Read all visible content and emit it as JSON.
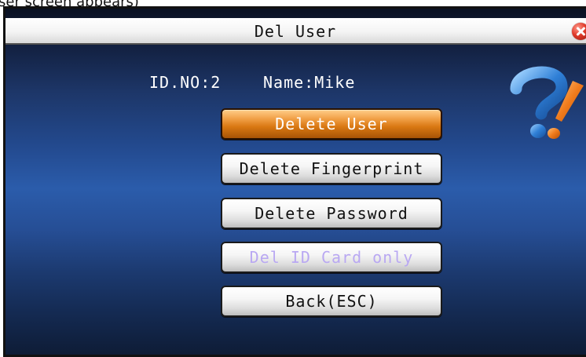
{
  "caption": "ser screen appears)",
  "window": {
    "title": "Del User",
    "close_icon": "close-icon"
  },
  "user_info": {
    "id_text": "ID.NO:2",
    "name_text": "Name:Mike"
  },
  "help_icon": "help-question-exclamation-icon",
  "menu": {
    "selected_index": 0,
    "items": [
      {
        "label": "Delete User",
        "state": "selected"
      },
      {
        "label": "Delete Fingerprint",
        "state": "normal"
      },
      {
        "label": "Delete Password",
        "state": "normal"
      },
      {
        "label": "Del ID Card only",
        "state": "disabled"
      },
      {
        "label": "Back(ESC)",
        "state": "normal"
      }
    ]
  },
  "colors": {
    "selected_button": "#e8892a",
    "disabled_text": "#b9a8f2",
    "background_blue": "#234a8f",
    "close_red": "#e03a2a",
    "help_question_blue": "#2f7fd6",
    "help_exclamation_orange": "#f07b1c"
  }
}
